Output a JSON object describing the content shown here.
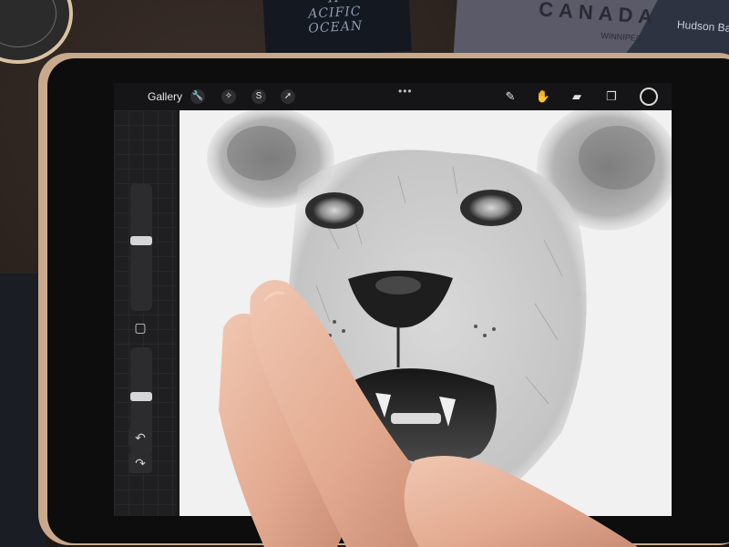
{
  "background": {
    "book_lines": [
      "H",
      "ACIFIC",
      "OCEAN"
    ],
    "map_country": "CANADA",
    "map_bay": "Hudson Bay",
    "map_city": "WINNIPEG"
  },
  "toolbar": {
    "gallery_label": "Gallery",
    "left_tools": [
      {
        "icon": "wrench-icon",
        "glyph": "🔧"
      },
      {
        "icon": "magic-wand-icon",
        "glyph": "✧"
      },
      {
        "icon": "selection-icon",
        "glyph": "S"
      },
      {
        "icon": "transform-arrow-icon",
        "glyph": "➚"
      }
    ],
    "more_dots": "•••",
    "right_tools": [
      {
        "icon": "brush-icon",
        "glyph": "✎",
        "active": false
      },
      {
        "icon": "smudge-icon",
        "glyph": "✋",
        "active": true
      },
      {
        "icon": "eraser-icon",
        "glyph": "▰",
        "active": false
      },
      {
        "icon": "layers-icon",
        "glyph": "❐",
        "active": false
      }
    ],
    "current_color": "#111111",
    "accent_color": "#2e7cf6"
  },
  "sidebar": {
    "brush_size_level": 0.55,
    "brush_opacity_level": 0.55,
    "modify_glyph": "▢",
    "undo_glyph": "↶",
    "redo_glyph": "↷"
  },
  "canvas": {
    "subject": "lion-face-sketch",
    "paper_color": "#f1f1f1"
  }
}
